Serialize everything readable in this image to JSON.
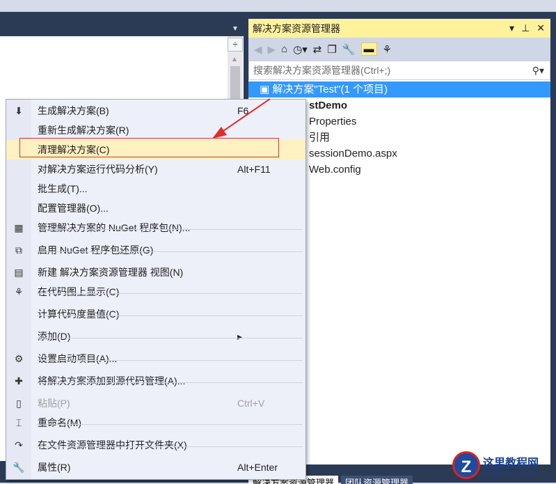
{
  "solution_explorer": {
    "title": "解决方案资源管理器",
    "search_placeholder": "搜索解决方案资源管理器(Ctrl+;)",
    "tree": [
      "解决方案\"Test\"(1 个项目)",
      "stDemo",
      "Properties",
      "引用",
      "sessionDemo.aspx",
      "Web.config"
    ]
  },
  "bottom_tabs": [
    "解决方案资源管理器",
    "团队资源管理器"
  ],
  "menu": [
    {
      "label": "生成解决方案(B)",
      "shortcut": "F6",
      "icon": "build-icon"
    },
    {
      "label": "重新生成解决方案(R)",
      "shortcut": "",
      "icon": ""
    },
    {
      "label": "清理解决方案(C)",
      "shortcut": "",
      "icon": ""
    },
    {
      "label": "对解决方案运行代码分析(Y)",
      "shortcut": "Alt+F11",
      "icon": ""
    },
    {
      "label": "批生成(T)...",
      "shortcut": "",
      "icon": ""
    },
    {
      "label": "配置管理器(O)...",
      "shortcut": "",
      "icon": ""
    },
    {
      "label": "管理解决方案的 NuGet 程序包(N)...",
      "shortcut": "",
      "icon": "nuget-icon"
    },
    {
      "label": "启用 NuGet 程序包还原(G)",
      "shortcut": "",
      "icon": "restore-icon"
    },
    {
      "label": "新建 解决方案资源管理器 视图(N)",
      "shortcut": "",
      "icon": "new-view-icon"
    },
    {
      "label": "在代码图上显示(C)",
      "shortcut": "",
      "icon": "code-map-icon"
    },
    {
      "label": "计算代码度量值(C)",
      "shortcut": "",
      "icon": ""
    },
    {
      "label": "添加(D)",
      "shortcut": "▸",
      "icon": ""
    },
    {
      "label": "设置启动项目(A)...",
      "shortcut": "",
      "icon": "gear-icon"
    },
    {
      "label": "将解决方案添加到源代码管理(A)...",
      "shortcut": "",
      "icon": "source-control-icon"
    },
    {
      "label": "粘贴(P)",
      "shortcut": "Ctrl+V",
      "icon": "paste-icon"
    },
    {
      "label": "重命名(M)",
      "shortcut": "",
      "icon": "rename-icon"
    },
    {
      "label": "在文件资源管理器中打开文件夹(X)",
      "shortcut": "",
      "icon": "open-folder-icon"
    },
    {
      "label": "属性(R)",
      "shortcut": "Alt+Enter",
      "icon": "wrench-icon"
    }
  ],
  "watermark": {
    "name": "这里教程网",
    "url": "herecours.com"
  }
}
